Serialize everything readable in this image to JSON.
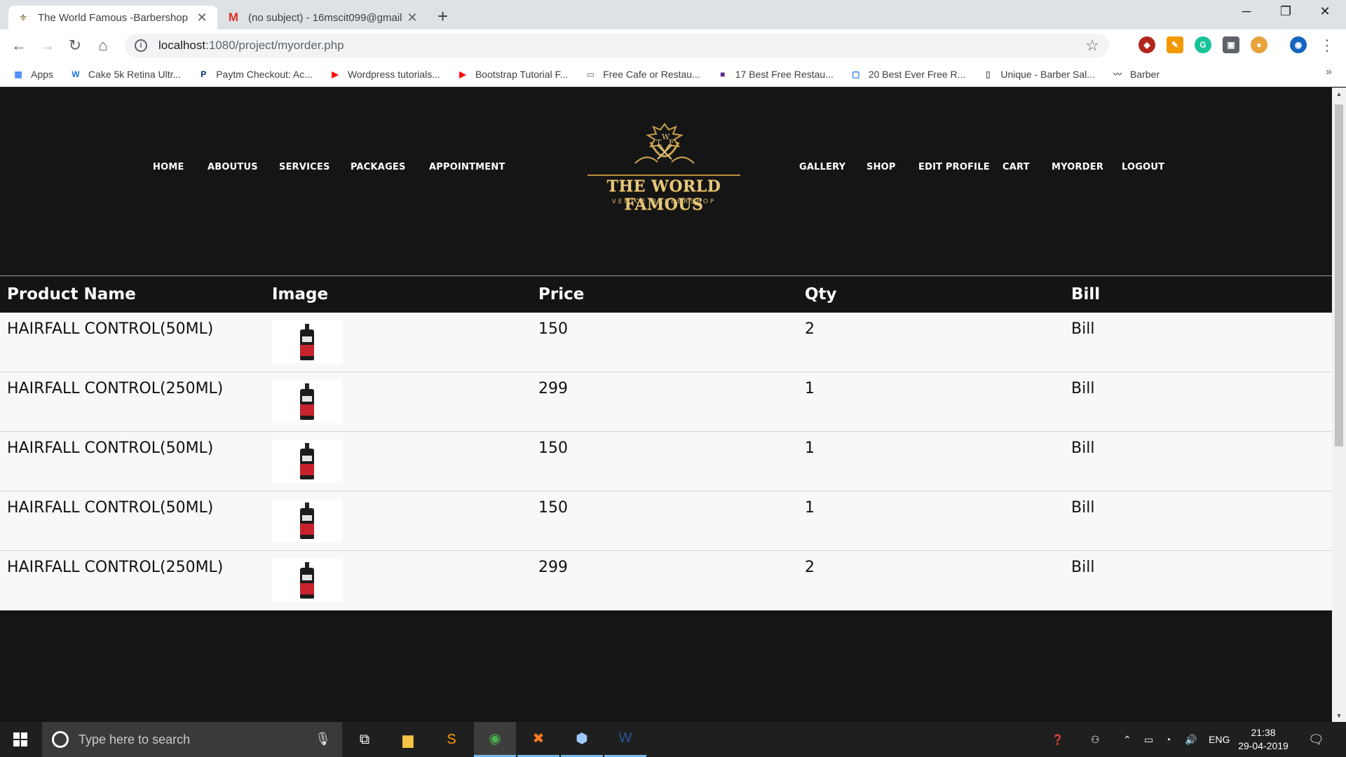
{
  "browser": {
    "tabs": [
      {
        "title": "The World Famous -Barbershop",
        "active": true,
        "favicon": "barber-pole-icon"
      },
      {
        "title": "(no subject) - 16mscit099@gmail",
        "active": false,
        "favicon": "gmail-icon"
      }
    ],
    "new_tab_label": "+",
    "window_controls": {
      "minimize": "─",
      "restore": "❐",
      "close": "✕"
    },
    "url_host": "localhost",
    "url_path": ":1080/project/myorder.php",
    "bookmarks": [
      {
        "label": "Apps",
        "icon": "apps-grid-icon",
        "color": "#4285f4"
      },
      {
        "label": "Cake 5k Retina Ultr...",
        "icon": "w-icon",
        "color": "#1a73e8"
      },
      {
        "label": "Paytm Checkout: Ac...",
        "icon": "paytm-icon",
        "color": "#002970"
      },
      {
        "label": "Wordpress tutorials...",
        "icon": "youtube-icon",
        "color": "#ff0000"
      },
      {
        "label": "Bootstrap Tutorial F...",
        "icon": "youtube-icon",
        "color": "#ff0000"
      },
      {
        "label": "Free Cafe or Restau...",
        "icon": "image-icon",
        "color": "#9aa0a6"
      },
      {
        "label": "17 Best Free Restau...",
        "icon": "colorlib-icon",
        "color": "#5c2d91"
      },
      {
        "label": "20 Best Ever Free R...",
        "icon": "bookmark-page-icon",
        "color": "#1a73e8"
      },
      {
        "label": "Unique - Barber Sal...",
        "icon": "page-icon",
        "color": "#5f6368"
      },
      {
        "label": "Barber",
        "icon": "mustache-icon",
        "color": "#5f6368"
      }
    ],
    "bookmarks_more": "»"
  },
  "site": {
    "nav_left": [
      "HOME",
      "ABOUTUS",
      "SERVICES",
      "PACKAGES",
      "APPOINTMENT"
    ],
    "nav_right": [
      "GALLERY",
      "SHOP",
      "EDIT PROFILE",
      "CART",
      "MYORDER",
      "LOGOUT"
    ],
    "logo": {
      "monogram_t": "T",
      "monogram_w": "W",
      "monogram_f": "F",
      "brand": "THE WORLD FAMOUS",
      "sub": "VENICE BARBERSHOP",
      "gold": "#e6c77d"
    }
  },
  "orders": {
    "columns": [
      "Product Name",
      "Image",
      "Price",
      "Qty",
      "Bill"
    ],
    "rows": [
      {
        "product": "HAIRFALL CONTROL(50ML)",
        "price": "150",
        "qty": "2",
        "bill": "Bill"
      },
      {
        "product": "HAIRFALL CONTROL(250ML)",
        "price": "299",
        "qty": "1",
        "bill": "Bill"
      },
      {
        "product": "HAIRFALL CONTROL(50ML)",
        "price": "150",
        "qty": "1",
        "bill": "Bill"
      },
      {
        "product": "HAIRFALL CONTROL(50ML)",
        "price": "150",
        "qty": "1",
        "bill": "Bill"
      },
      {
        "product": "HAIRFALL CONTROL(250ML)",
        "price": "299",
        "qty": "2",
        "bill": "Bill"
      }
    ]
  },
  "taskbar": {
    "search_placeholder": "Type here to search",
    "tray_language": "ENG",
    "time": "21:38",
    "date": "29-04-2019"
  }
}
